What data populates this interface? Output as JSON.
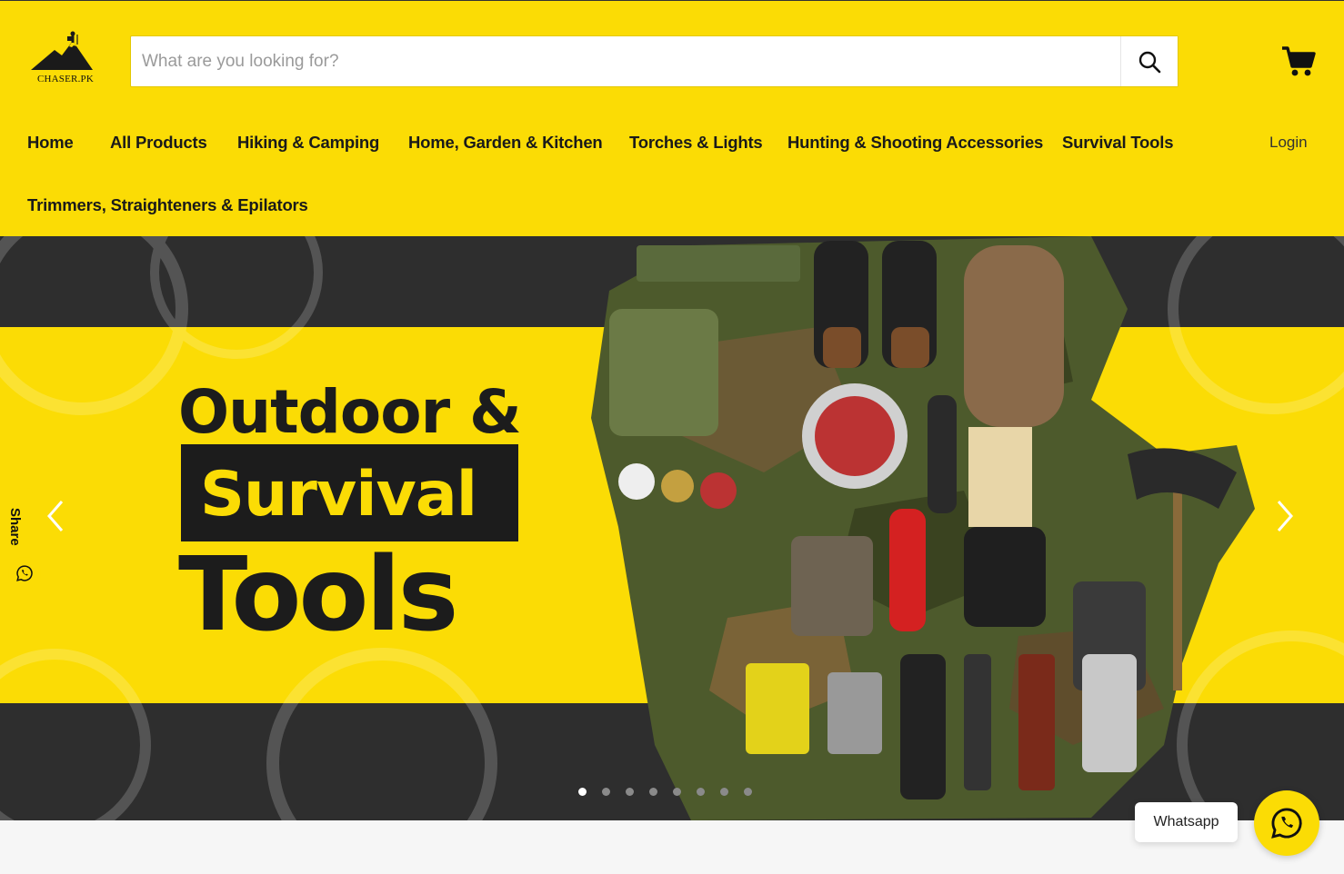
{
  "brand": {
    "logo_text": "CHASER.PK",
    "logo_icon": "mountain-hiker-logo"
  },
  "search": {
    "placeholder": "What are you looking for?",
    "value": "",
    "icon": "search-icon"
  },
  "cart": {
    "icon": "cart-icon"
  },
  "nav": {
    "items": [
      {
        "label": "Home"
      },
      {
        "label": "All Products"
      },
      {
        "label": "Hiking & Camping"
      },
      {
        "label": "Home, Garden & Kitchen"
      },
      {
        "label": "Torches & Lights"
      },
      {
        "label": "Hunting & Shooting Accessories"
      },
      {
        "label": "Survival Tools"
      },
      {
        "label": "Trimmers, Straighteners & Epilators"
      }
    ],
    "login": "Login"
  },
  "hero": {
    "line1": "Outdoor &",
    "line2": "Survival",
    "line3": "Tools",
    "slide_count": 8,
    "active_slide": 1,
    "prev_icon": "chevron-left-icon",
    "next_icon": "chevron-right-icon"
  },
  "share": {
    "label": "Share",
    "icon": "whatsapp-icon"
  },
  "whatsapp": {
    "label": "Whatsapp",
    "icon": "whatsapp-icon"
  },
  "colors": {
    "brand_yellow": "#fbdc05",
    "dark": "#1c1c1c",
    "hero_dark": "#2e2e2e"
  }
}
